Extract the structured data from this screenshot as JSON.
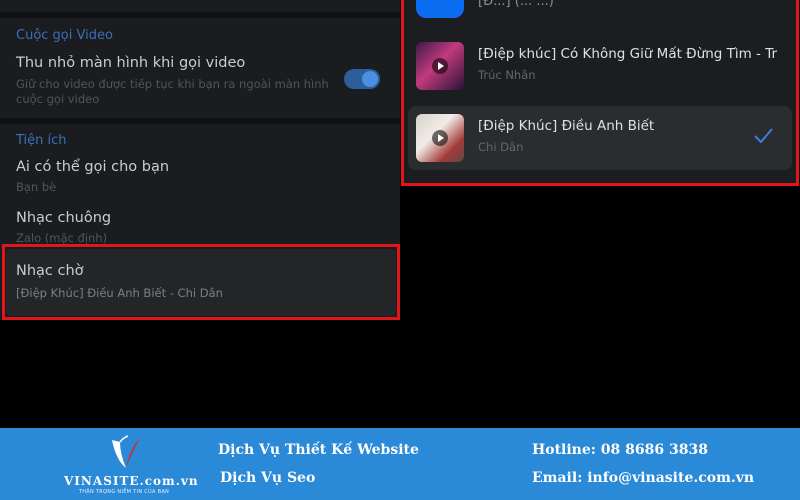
{
  "settings": {
    "video_section": {
      "title": "Cuộc gọi Video",
      "item_title": "Thu nhỏ màn hình khi gọi video",
      "item_sub_line1": "Giữ cho video được tiếp tục khi bạn ra ngoài màn hình",
      "item_sub_line2": "cuộc gọi video",
      "toggle_on": true
    },
    "util_section": {
      "title": "Tiện ích",
      "items": [
        {
          "title": "Ai có thể gọi cho bạn",
          "sub": "Bạn bè"
        },
        {
          "title": "Nhạc chuông",
          "sub": "Zalo (mặc định)"
        },
        {
          "title": "Nhạc chờ",
          "sub": "[Điệp Khúc] Điều Anh Biết - Chi Dân"
        }
      ]
    }
  },
  "music": {
    "top_cut_text": "[Đ...] (... ...)",
    "songs": [
      {
        "title": "[Điệp khúc] Có Không Giữ Mất Đừng Tìm - Trú...",
        "artist": "Trúc Nhân",
        "selected": false
      },
      {
        "title": "[Điệp Khúc] Điều Anh Biết",
        "artist": "Chi Dân",
        "selected": true
      }
    ]
  },
  "footer": {
    "logo_text": "VINASITE.com.vn",
    "logo_tagline": "THẬN TRỌNG NIỀM TIN CỦA BẠN",
    "service1": "Dịch Vụ Thiết Kế Website",
    "service2": "Dịch Vụ Seo",
    "hotline": "Hotline: 08 8686 3838",
    "email": "Email: info@vinasite.com.vn"
  },
  "colors": {
    "accent_blue": "#3b6fb6",
    "highlight_red": "#e1161b",
    "footer_blue": "#2a8ad8"
  }
}
